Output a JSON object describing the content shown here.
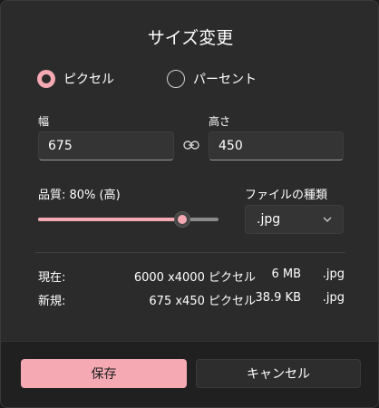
{
  "dialog": {
    "title": "サイズ変更"
  },
  "mode": {
    "options": [
      {
        "label": "ピクセル",
        "checked": true
      },
      {
        "label": "パーセント",
        "checked": false
      }
    ]
  },
  "dimensions": {
    "width_label": "幅",
    "width_value": "675",
    "height_label": "高さ",
    "height_value": "450",
    "link_icon": "link-icon"
  },
  "quality": {
    "label": "品質: 80% (高)",
    "value_percent": 80
  },
  "file_type": {
    "label": "ファイルの種類",
    "selected": ".jpg"
  },
  "info": {
    "current": {
      "key": "現在:",
      "dims": "6000 x4000 ピクセル",
      "size": "6 MB",
      "ext": ".jpg"
    },
    "new": {
      "key": "新規:",
      "dims": "675 x450 ピクセル",
      "size": "38.9 KB",
      "ext": ".jpg"
    }
  },
  "footer": {
    "save_label": "保存",
    "cancel_label": "キャンセル"
  },
  "colors": {
    "accent": "#f4a9b3",
    "background": "#2b2b2b",
    "footer": "#202020"
  }
}
